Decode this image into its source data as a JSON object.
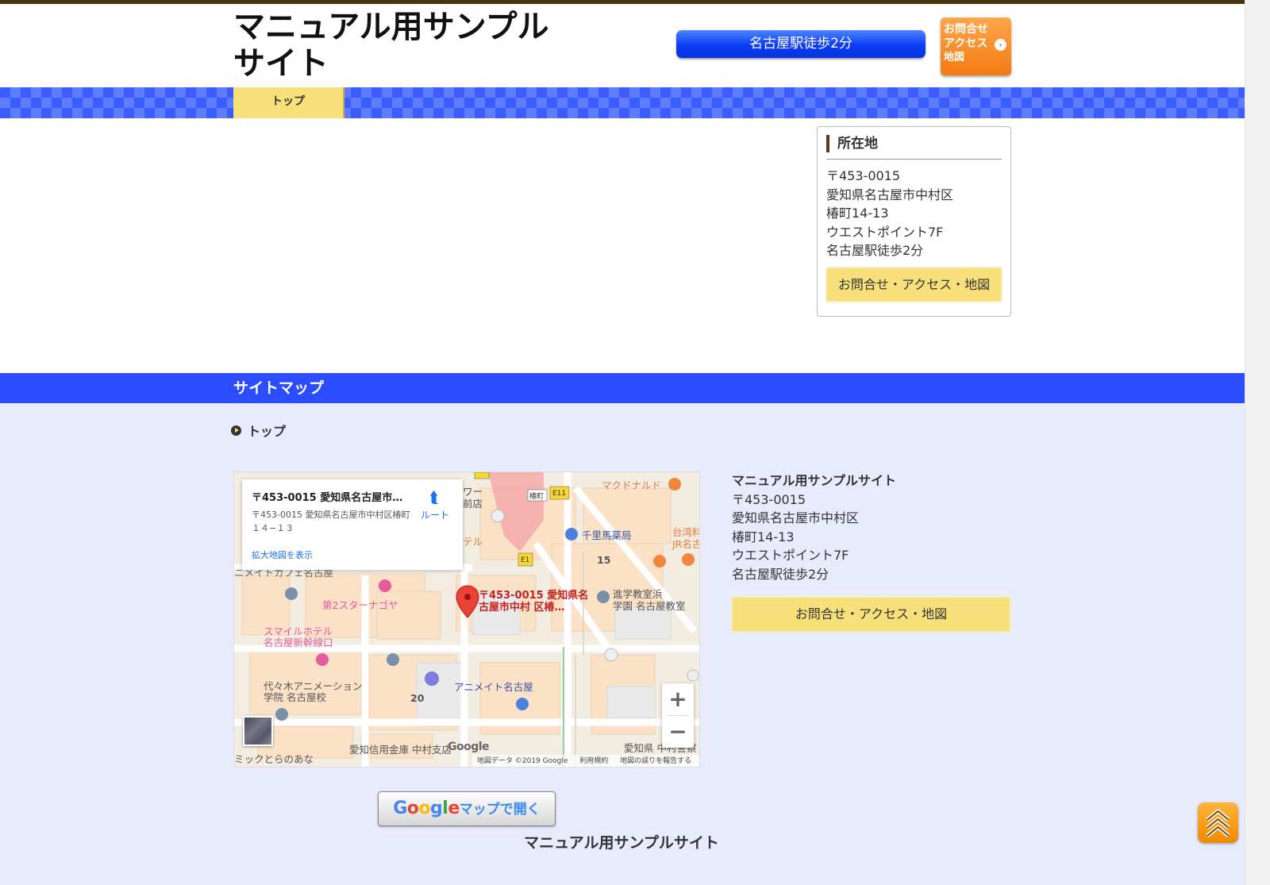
{
  "header": {
    "site_title": "マニュアル用サンプルサイト",
    "station_button": "名古屋駅徒歩2分",
    "contact_button": {
      "line1": "お問合せ",
      "line2": "アクセス",
      "line3": "地図"
    }
  },
  "nav": {
    "items": [
      {
        "label": "トップ"
      }
    ]
  },
  "sidebar": {
    "heading": "所在地",
    "postal": "〒453-0015",
    "address1": "愛知県名古屋市中村区",
    "address2": "椿町14-13",
    "building": "ウエストポイント7F",
    "access": "名古屋駅徒歩2分",
    "button": "お問合せ・アクセス・地図"
  },
  "sitemap": {
    "title": "サイトマップ",
    "links": [
      {
        "label": "トップ"
      }
    ]
  },
  "map": {
    "card_title": "〒453-0015 愛知県名古屋市中…",
    "card_address": "〒453-0015 愛知県名古屋市中村区椿町１４−１３",
    "route_label": "ルート",
    "larger_map": "拡大地図を表示",
    "pin_label": "〒453-0015 愛知県名古屋市中村 区椿…",
    "zoom_in": "+",
    "zoom_out": "−",
    "google_logo": "Google",
    "footer": {
      "data": "地図データ ©2019 Google",
      "terms": "利用規約",
      "report": "地図の誤りを報告する"
    },
    "labels": {
      "mcdonalds": "マクドナルド",
      "pharmacy": "千里馬薬局",
      "taiwan": "台湾料",
      "jr": "JR名古",
      "cafe": "ニメイトカフェ名古屋",
      "star": "第2スターナゴヤ",
      "school": "進学教室浜",
      "school2": "学園 名古屋教室",
      "smile1": "スマイルホテル",
      "smile2": "名古屋新幹線口",
      "yoyogi1": "代々木アニメーション",
      "yoyogi2": "学院 名古屋校",
      "animate": "アニメイト名古屋",
      "bank": "愛知信用金庫 中村支店",
      "police": "愛知県 中村警察",
      "shop": "ミックとらのあな",
      "num15": "15",
      "num20": "20",
      "hotel": "テル",
      "shop2": "ワー",
      "shop3": "前店",
      "e1": "E1",
      "e11": "E11",
      "station": "椿町"
    }
  },
  "open_in_google_maps": {
    "google": "Google",
    "rest": "マップで開く"
  },
  "info": {
    "name": "マニュアル用サンプルサイト",
    "postal": "〒453-0015",
    "address1": "愛知県名古屋市中村区",
    "address2": "椿町14-13",
    "building": "ウエストポイント7F",
    "access": "名古屋駅徒歩2分",
    "button": "お問合せ・アクセス・地図"
  },
  "footer": {
    "site_name": "マニュアル用サンプルサイト"
  },
  "colors": {
    "accent_blue": "#2c4cff",
    "nav_yellow": "#f7e07a",
    "contact_orange": "#f57a12",
    "lower_bg": "#e8ebfd"
  },
  "icons": {
    "contact_arrow": "chevron-right-circle-icon",
    "sitemap_bullet": "play-circle-icon",
    "page_top": "double-chevron-up-icon",
    "route": "directions-icon",
    "pin": "map-pin-icon"
  }
}
